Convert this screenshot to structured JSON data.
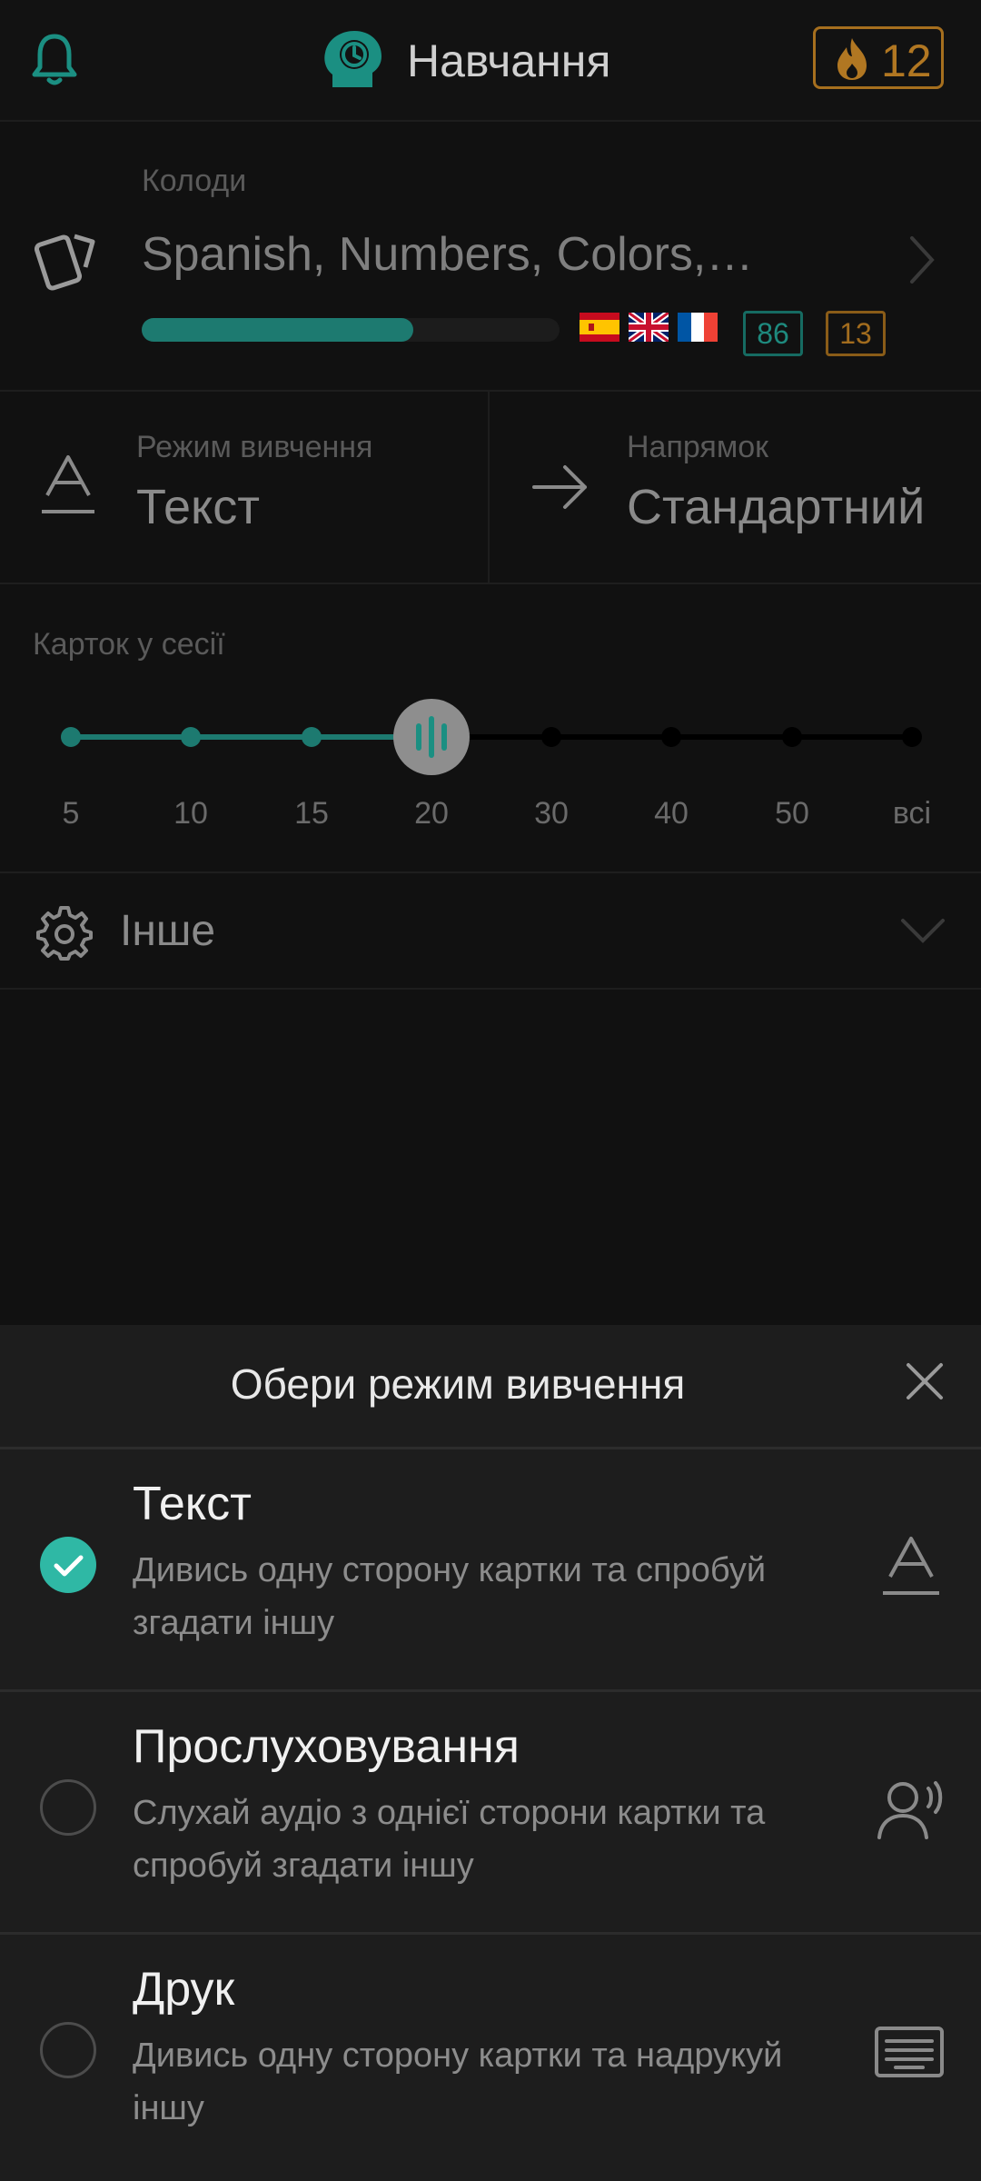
{
  "header": {
    "title": "Навчання",
    "streak_count": "12",
    "icons": {
      "notifications": "bell-icon",
      "logo": "brain-clock-icon",
      "streak": "flame-icon"
    }
  },
  "decks": {
    "label": "Колоди",
    "names": "Spanish, Numbers, Colors,…",
    "progress": 0.65,
    "flags": [
      "spain-flag",
      "uk-flag",
      "france-flag"
    ],
    "count_green": "86",
    "count_orange": "13",
    "icon": "cards-icon"
  },
  "study_mode": {
    "label": "Режим вивчення",
    "value": "Текст",
    "icon": "text-format-icon"
  },
  "direction": {
    "label": "Напрямок",
    "value": "Стандартний",
    "icon": "arrow-right-icon"
  },
  "session": {
    "label": "Карток у сесії",
    "ticks": [
      "5",
      "10",
      "15",
      "20",
      "30",
      "40",
      "50",
      "всі"
    ],
    "selected_index": 3
  },
  "other": {
    "label": "Інше",
    "icon": "gear-icon"
  },
  "sheet": {
    "title": "Обери режим вивчення",
    "options": [
      {
        "title": "Текст",
        "desc": "Дивись одну сторону картки та спробуй згадати іншу",
        "selected": true,
        "icon": "text-format-icon"
      },
      {
        "title": "Прослуховування",
        "desc": "Слухай аудіо з однієї сторони картки та спробуй згадати іншу",
        "selected": false,
        "icon": "speaking-person-icon"
      },
      {
        "title": "Друк",
        "desc": "Дивись одну сторону картки та надрукуй іншу",
        "selected": false,
        "icon": "keyboard-icon"
      }
    ]
  },
  "colors": {
    "accent": "#2fb8a5",
    "streak": "#b17722",
    "background": "#111111",
    "sheet": "#1d1d1d"
  }
}
